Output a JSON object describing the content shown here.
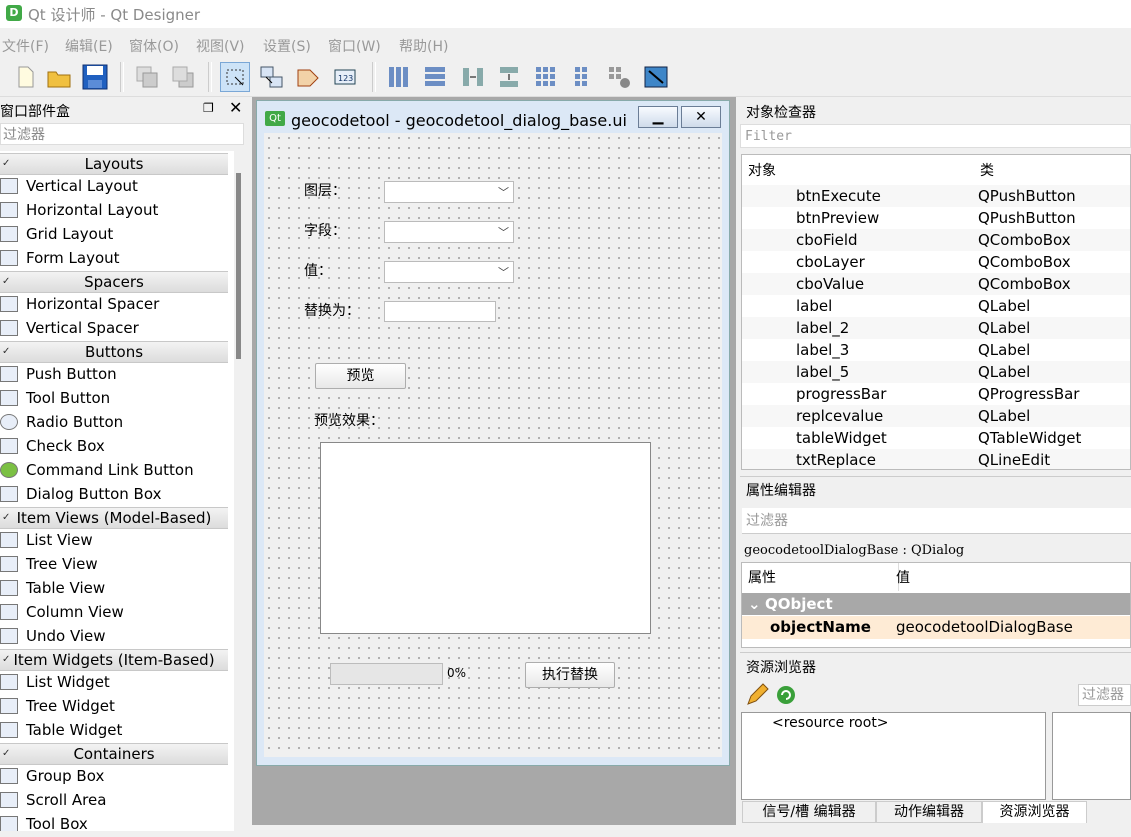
{
  "window": {
    "title": "Qt 设计师 - Qt Designer",
    "icon": "D"
  },
  "menubar": [
    "文件(F)",
    "编辑(E)",
    "窗体(O)",
    "视图(V)",
    "设置(S)",
    "窗口(W)",
    "帮助(H)"
  ],
  "widget_box": {
    "title": "窗口部件盒",
    "filter_placeholder": "过滤器",
    "categories": {
      "layouts": "Layouts",
      "spacers": "Spacers",
      "buttons": "Buttons",
      "item_views": "Item Views (Model-Based)",
      "item_widgets": "Item Widgets (Item-Based)",
      "containers": "Containers"
    },
    "items": {
      "vertical_layout": "Vertical Layout",
      "horizontal_layout": "Horizontal Layout",
      "grid_layout": "Grid Layout",
      "form_layout": "Form Layout",
      "horizontal_spacer": "Horizontal Spacer",
      "vertical_spacer": "Vertical Spacer",
      "push_button": "Push Button",
      "tool_button": "Tool Button",
      "radio_button": "Radio Button",
      "check_box": "Check Box",
      "command_link_button": "Command Link Button",
      "dialog_button_box": "Dialog Button Box",
      "list_view": "List View",
      "tree_view": "Tree View",
      "table_view": "Table View",
      "column_view": "Column View",
      "undo_view": "Undo View",
      "list_widget": "List Widget",
      "tree_widget": "Tree Widget",
      "table_widget": "Table Widget",
      "group_box": "Group Box",
      "scroll_area": "Scroll Area",
      "tool_box": "Tool Box"
    }
  },
  "form": {
    "title": "geocodetool - geocodetool_dialog_base.ui",
    "qt_icon": "Qt",
    "layer_label": "图层：",
    "field_label": "字段：",
    "value_label": "值：",
    "replace_label": "替换为：",
    "preview_button": "预览",
    "preview_result_label": "预览效果：",
    "progress_text": "0%",
    "progress_value": 0,
    "execute_button": "执行替换"
  },
  "object_inspector": {
    "title": "对象检查器",
    "filter_placeholder": "Filter",
    "col_object": "对象",
    "col_class": "类",
    "rows": [
      {
        "name": "btnExecute",
        "cls": "QPushButton"
      },
      {
        "name": "btnPreview",
        "cls": "QPushButton"
      },
      {
        "name": "cboField",
        "cls": "QComboBox"
      },
      {
        "name": "cboLayer",
        "cls": "QComboBox"
      },
      {
        "name": "cboValue",
        "cls": "QComboBox"
      },
      {
        "name": "label",
        "cls": "QLabel"
      },
      {
        "name": "label_2",
        "cls": "QLabel"
      },
      {
        "name": "label_3",
        "cls": "QLabel"
      },
      {
        "name": "label_5",
        "cls": "QLabel"
      },
      {
        "name": "progressBar",
        "cls": "QProgressBar"
      },
      {
        "name": "replcevalue",
        "cls": "QLabel"
      },
      {
        "name": "tableWidget",
        "cls": "QTableWidget"
      },
      {
        "name": "txtReplace",
        "cls": "QLineEdit"
      }
    ]
  },
  "property_editor": {
    "title": "属性编辑器",
    "filter_placeholder": "过滤器",
    "class_line": "geocodetoolDialogBase : QDialog",
    "col_property": "属性",
    "col_value": "值",
    "group": "QObject",
    "prop_name": "objectName",
    "prop_value": "geocodetoolDialogBase"
  },
  "resource_browser": {
    "title": "资源浏览器",
    "filter_placeholder": "过滤器",
    "root": "<resource root>"
  },
  "bottom_tabs": [
    "信号/槽 编辑器",
    "动作编辑器",
    "资源浏览器"
  ]
}
